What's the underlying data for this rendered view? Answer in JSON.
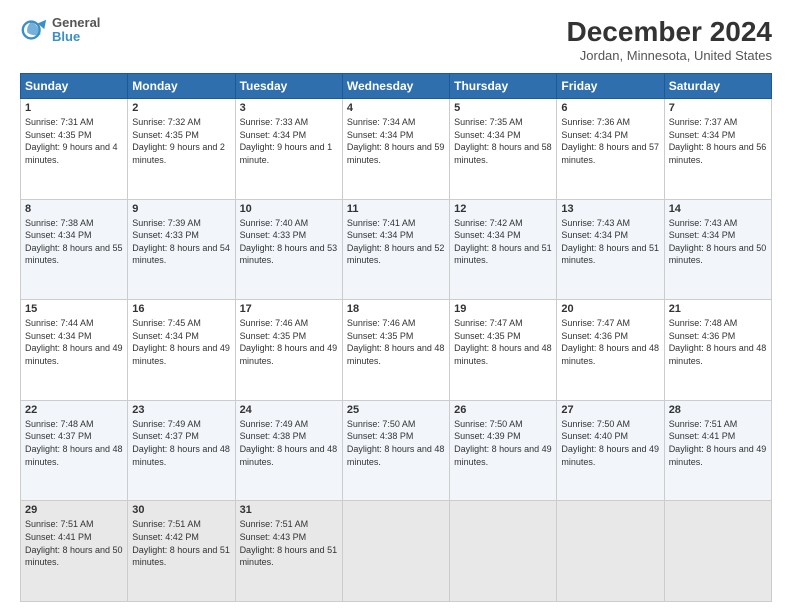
{
  "header": {
    "logo_line1": "General",
    "logo_line2": "Blue",
    "title": "December 2024",
    "location": "Jordan, Minnesota, United States"
  },
  "days_of_week": [
    "Sunday",
    "Monday",
    "Tuesday",
    "Wednesday",
    "Thursday",
    "Friday",
    "Saturday"
  ],
  "weeks": [
    [
      {
        "day": "1",
        "sunrise": "7:31 AM",
        "sunset": "4:35 PM",
        "daylight": "9 hours and 4 minutes."
      },
      {
        "day": "2",
        "sunrise": "7:32 AM",
        "sunset": "4:35 PM",
        "daylight": "9 hours and 2 minutes."
      },
      {
        "day": "3",
        "sunrise": "7:33 AM",
        "sunset": "4:34 PM",
        "daylight": "9 hours and 1 minute."
      },
      {
        "day": "4",
        "sunrise": "7:34 AM",
        "sunset": "4:34 PM",
        "daylight": "8 hours and 59 minutes."
      },
      {
        "day": "5",
        "sunrise": "7:35 AM",
        "sunset": "4:34 PM",
        "daylight": "8 hours and 58 minutes."
      },
      {
        "day": "6",
        "sunrise": "7:36 AM",
        "sunset": "4:34 PM",
        "daylight": "8 hours and 57 minutes."
      },
      {
        "day": "7",
        "sunrise": "7:37 AM",
        "sunset": "4:34 PM",
        "daylight": "8 hours and 56 minutes."
      }
    ],
    [
      {
        "day": "8",
        "sunrise": "7:38 AM",
        "sunset": "4:34 PM",
        "daylight": "8 hours and 55 minutes."
      },
      {
        "day": "9",
        "sunrise": "7:39 AM",
        "sunset": "4:33 PM",
        "daylight": "8 hours and 54 minutes."
      },
      {
        "day": "10",
        "sunrise": "7:40 AM",
        "sunset": "4:33 PM",
        "daylight": "8 hours and 53 minutes."
      },
      {
        "day": "11",
        "sunrise": "7:41 AM",
        "sunset": "4:34 PM",
        "daylight": "8 hours and 52 minutes."
      },
      {
        "day": "12",
        "sunrise": "7:42 AM",
        "sunset": "4:34 PM",
        "daylight": "8 hours and 51 minutes."
      },
      {
        "day": "13",
        "sunrise": "7:43 AM",
        "sunset": "4:34 PM",
        "daylight": "8 hours and 51 minutes."
      },
      {
        "day": "14",
        "sunrise": "7:43 AM",
        "sunset": "4:34 PM",
        "daylight": "8 hours and 50 minutes."
      }
    ],
    [
      {
        "day": "15",
        "sunrise": "7:44 AM",
        "sunset": "4:34 PM",
        "daylight": "8 hours and 49 minutes."
      },
      {
        "day": "16",
        "sunrise": "7:45 AM",
        "sunset": "4:34 PM",
        "daylight": "8 hours and 49 minutes."
      },
      {
        "day": "17",
        "sunrise": "7:46 AM",
        "sunset": "4:35 PM",
        "daylight": "8 hours and 49 minutes."
      },
      {
        "day": "18",
        "sunrise": "7:46 AM",
        "sunset": "4:35 PM",
        "daylight": "8 hours and 48 minutes."
      },
      {
        "day": "19",
        "sunrise": "7:47 AM",
        "sunset": "4:35 PM",
        "daylight": "8 hours and 48 minutes."
      },
      {
        "day": "20",
        "sunrise": "7:47 AM",
        "sunset": "4:36 PM",
        "daylight": "8 hours and 48 minutes."
      },
      {
        "day": "21",
        "sunrise": "7:48 AM",
        "sunset": "4:36 PM",
        "daylight": "8 hours and 48 minutes."
      }
    ],
    [
      {
        "day": "22",
        "sunrise": "7:48 AM",
        "sunset": "4:37 PM",
        "daylight": "8 hours and 48 minutes."
      },
      {
        "day": "23",
        "sunrise": "7:49 AM",
        "sunset": "4:37 PM",
        "daylight": "8 hours and 48 minutes."
      },
      {
        "day": "24",
        "sunrise": "7:49 AM",
        "sunset": "4:38 PM",
        "daylight": "8 hours and 48 minutes."
      },
      {
        "day": "25",
        "sunrise": "7:50 AM",
        "sunset": "4:38 PM",
        "daylight": "8 hours and 48 minutes."
      },
      {
        "day": "26",
        "sunrise": "7:50 AM",
        "sunset": "4:39 PM",
        "daylight": "8 hours and 49 minutes."
      },
      {
        "day": "27",
        "sunrise": "7:50 AM",
        "sunset": "4:40 PM",
        "daylight": "8 hours and 49 minutes."
      },
      {
        "day": "28",
        "sunrise": "7:51 AM",
        "sunset": "4:41 PM",
        "daylight": "8 hours and 49 minutes."
      }
    ],
    [
      {
        "day": "29",
        "sunrise": "7:51 AM",
        "sunset": "4:41 PM",
        "daylight": "8 hours and 50 minutes."
      },
      {
        "day": "30",
        "sunrise": "7:51 AM",
        "sunset": "4:42 PM",
        "daylight": "8 hours and 51 minutes."
      },
      {
        "day": "31",
        "sunrise": "7:51 AM",
        "sunset": "4:43 PM",
        "daylight": "8 hours and 51 minutes."
      },
      null,
      null,
      null,
      null
    ]
  ]
}
